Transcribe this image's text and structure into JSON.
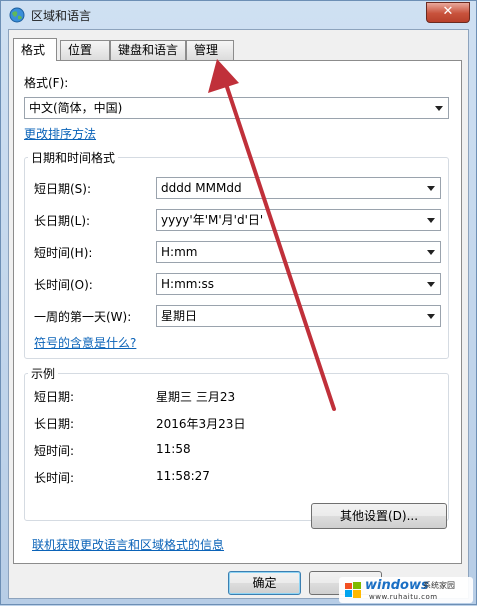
{
  "window": {
    "title": "区域和语言",
    "close_glyph": "✕"
  },
  "tabs": [
    {
      "label": "格式"
    },
    {
      "label": "位置"
    },
    {
      "label": "键盘和语言"
    },
    {
      "label": "管理"
    }
  ],
  "format": {
    "label": "格式(F):",
    "value": "中文(简体，中国)",
    "change_sort_link": "更改排序方法"
  },
  "datetime_group": {
    "title": "日期和时间格式",
    "rows": [
      {
        "label": "短日期(S):",
        "value": "dddd  MMMdd"
      },
      {
        "label": "长日期(L):",
        "value": "yyyy'年'M'月'd'日'"
      },
      {
        "label": "短时间(H):",
        "value": "H:mm"
      },
      {
        "label": "长时间(O):",
        "value": "H:mm:ss"
      },
      {
        "label": "一周的第一天(W):",
        "value": "星期日"
      }
    ],
    "symbols_link": "符号的含意是什么?"
  },
  "examples": {
    "title": "示例",
    "rows": [
      {
        "label": "短日期:",
        "value": "星期三  三月23"
      },
      {
        "label": "长日期:",
        "value": "2016年3月23日"
      },
      {
        "label": "短时间:",
        "value": "11:58"
      },
      {
        "label": "长时间:",
        "value": "11:58:27"
      }
    ]
  },
  "buttons": {
    "other_settings": "其他设置(D)...",
    "ok": "确定"
  },
  "online_link": "联机获取更改语言和区域格式的信息",
  "watermark": {
    "brand": "windows",
    "site": "系统家园",
    "url": "www.ruhaitu.com"
  },
  "colors": {
    "link": "#0b63b8",
    "annotation_arrow": "#c0303a",
    "close_button": "#c8523c"
  },
  "icons": [
    "globe-icon",
    "close-icon",
    "chevron-down-icon",
    "annotation-arrow",
    "windows-logo-icon"
  ]
}
